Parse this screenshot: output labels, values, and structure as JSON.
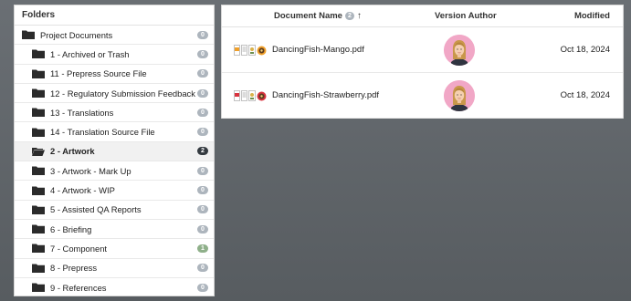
{
  "folders": {
    "header": "Folders",
    "items": [
      {
        "label": "Project Documents",
        "count": "0",
        "level": "root",
        "selected": false,
        "badge": "gray"
      },
      {
        "label": "1 - Archived or Trash",
        "count": "0",
        "level": "child",
        "selected": false,
        "badge": "gray"
      },
      {
        "label": "11 - Prepress Source File",
        "count": "0",
        "level": "child",
        "selected": false,
        "badge": "gray"
      },
      {
        "label": "12 - Regulatory Submission Feedback",
        "count": "0",
        "level": "child",
        "selected": false,
        "badge": "gray"
      },
      {
        "label": "13 - Translations",
        "count": "0",
        "level": "child",
        "selected": false,
        "badge": "gray"
      },
      {
        "label": "14 - Translation Source File",
        "count": "0",
        "level": "child",
        "selected": false,
        "badge": "gray"
      },
      {
        "label": "2 - Artwork",
        "count": "2",
        "level": "child",
        "selected": true,
        "badge": "dark"
      },
      {
        "label": "3 - Artwork - Mark Up",
        "count": "0",
        "level": "child",
        "selected": false,
        "badge": "gray"
      },
      {
        "label": "4 - Artwork - WIP",
        "count": "0",
        "level": "child",
        "selected": false,
        "badge": "gray"
      },
      {
        "label": "5 - Assisted QA Reports",
        "count": "0",
        "level": "child",
        "selected": false,
        "badge": "gray"
      },
      {
        "label": "6 - Briefing",
        "count": "0",
        "level": "child",
        "selected": false,
        "badge": "gray"
      },
      {
        "label": "7 - Component",
        "count": "1",
        "level": "child",
        "selected": false,
        "badge": "green"
      },
      {
        "label": "8 - Prepress",
        "count": "0",
        "level": "child",
        "selected": false,
        "badge": "gray"
      },
      {
        "label": "9 - References",
        "count": "0",
        "level": "child",
        "selected": false,
        "badge": "gray"
      }
    ]
  },
  "documents": {
    "columns": {
      "name": "Document Name",
      "name_count": "2",
      "sort_indicator": "↑",
      "author": "Version Author",
      "modified": "Modified"
    },
    "rows": [
      {
        "name": "DancingFish-Mango.pdf",
        "modified": "Oct 18, 2024",
        "accent": "#f0a02a"
      },
      {
        "name": "DancingFish-Strawberry.pdf",
        "modified": "Oct 18, 2024",
        "accent": "#d9333f"
      }
    ]
  },
  "colors": {
    "badge_gray": "#adb5bd",
    "badge_dark": "#343a40",
    "badge_green": "#8fb08a",
    "avatar_bg": "#f1a7c6"
  }
}
